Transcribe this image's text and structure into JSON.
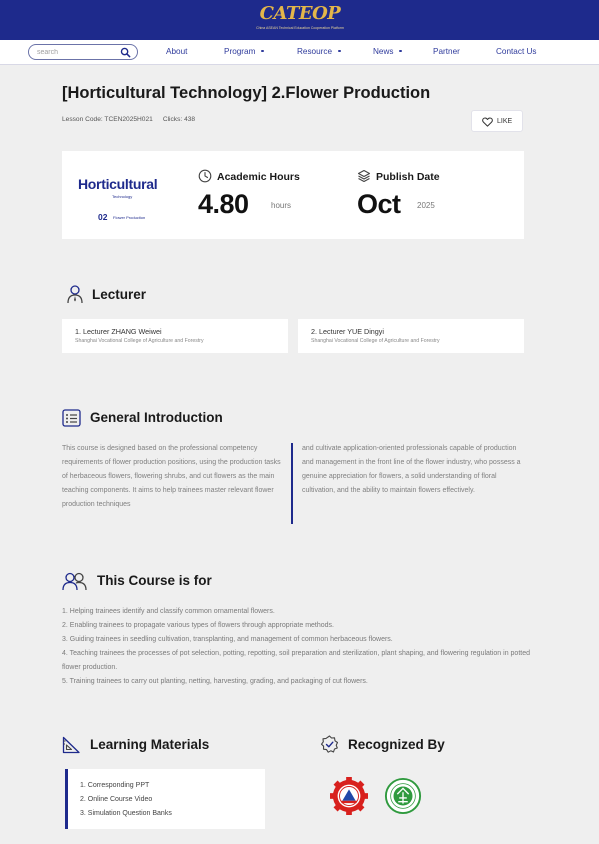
{
  "header": {
    "logo_text": "CATEOP",
    "logo_subtitle": "China ASEAN Technical Education Cooperation Platform"
  },
  "nav": {
    "search_placeholder": "search",
    "items": [
      {
        "label": "About",
        "has_dropdown": false
      },
      {
        "label": "Program",
        "has_dropdown": true
      },
      {
        "label": "Resource",
        "has_dropdown": true
      },
      {
        "label": "News",
        "has_dropdown": true
      },
      {
        "label": "Partner",
        "has_dropdown": false
      },
      {
        "label": "Contact Us",
        "has_dropdown": false
      }
    ]
  },
  "lesson": {
    "title": "[Horticultural Technology] 2.Flower Production",
    "code_label": "Lesson Code:",
    "code": "TCEN2025H021",
    "clicks_label": "Clicks:",
    "clicks": "438",
    "like_label": "LIKE"
  },
  "cover": {
    "title": "Horticultural",
    "subtitle": "Technology",
    "number": "02",
    "number_label": "Flower Production"
  },
  "stats": {
    "hours_label": "Academic Hours",
    "hours_value": "4.80",
    "hours_unit": "hours",
    "date_label": "Publish Date",
    "date_value": "Oct",
    "date_year": "2025"
  },
  "lecturer": {
    "heading": "Lecturer",
    "items": [
      {
        "name": "1. Lecturer ZHANG Weiwei",
        "org": "Shanghai Vocational College of Agriculture and Forestry"
      },
      {
        "name": "2. Lecturer YUE Dingyi",
        "org": "Shanghai Vocational College of Agriculture and Forestry"
      }
    ]
  },
  "intro": {
    "heading": "General Introduction",
    "left": "This course is designed based on the professional competency requirements of flower production positions, using the production tasks of herbaceous flowers, flowering shrubs, and cut flowers as the main teaching components. It aims to help trainees master relevant flower production techniques",
    "right": "and cultivate application-oriented professionals capable of production and management in the front line of the flower industry, who possess a genuine appreciation for flowers, a solid understanding of floral cultivation, and the ability to maintain flowers effectively."
  },
  "audience": {
    "heading": "This Course is for",
    "items": [
      "1. Helping trainees identify and classify common ornamental flowers.",
      "2. Enabling trainees to propagate various types of flowers through appropriate methods.",
      "3. Guiding trainees in seedling cultivation, transplanting, and management of common herbaceous flowers.",
      "4. Teaching trainees the processes of pot selection, potting, repotting, soil preparation and sterilization, plant shaping, and flowering regulation in potted flower production.",
      "5. Training trainees to carry out planting, netting, harvesting, grading, and packaging of cut flowers."
    ]
  },
  "materials": {
    "heading": "Learning Materials",
    "items": [
      "1. Corresponding PPT",
      "2. Online Course Video",
      "3. Simulation Question Banks"
    ]
  },
  "recognized": {
    "heading": "Recognized By",
    "badges": [
      "gear-seal-badge",
      "green-circle-seal-badge"
    ]
  },
  "colors": {
    "brand_navy": "#1e2a8c",
    "logo_gold": "#e3b64a",
    "page_bg": "#efefef",
    "seal_red": "#d8201d",
    "seal_green": "#2f9a3e"
  }
}
